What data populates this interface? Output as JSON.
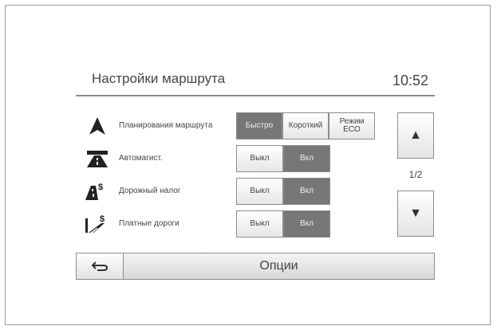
{
  "header": {
    "title": "Настройки маршрута",
    "time": "10:52"
  },
  "rows": [
    {
      "label": "Планирования маршрута",
      "icon": "navigation-arrow-icon",
      "options": [
        "Быстро",
        "Короткий",
        "Режим\nECO"
      ],
      "selected": 0
    },
    {
      "label": "Автомагист.",
      "icon": "highway-icon",
      "options": [
        "Выкл",
        "Вкл"
      ],
      "selected": 1
    },
    {
      "label": "Дорожный налог",
      "icon": "toll-road-icon",
      "options": [
        "Выкл",
        "Вкл"
      ],
      "selected": 1
    },
    {
      "label": "Платные дороги",
      "icon": "paid-road-icon",
      "options": [
        "Выкл",
        "Вкл"
      ],
      "selected": 1
    }
  ],
  "pagination": {
    "text": "1/2",
    "up_icon": "up-arrow-icon",
    "down_icon": "down-arrow-icon"
  },
  "footer": {
    "back_icon": "back-arrow-icon",
    "options_label": "Опции"
  },
  "colors": {
    "selected": "#777777",
    "unselected": "#f2f2f2"
  }
}
